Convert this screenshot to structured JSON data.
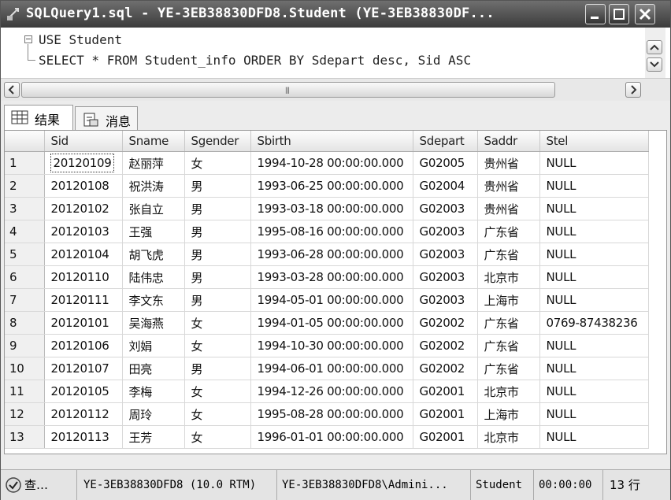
{
  "window": {
    "title": "SQLQuery1.sql - YE-3EB38830DFD8.Student (YE-3EB38830DF..."
  },
  "editor": {
    "line1": "USE Student",
    "line2": "SELECT * FROM Student_info ORDER BY Sdepart desc, Sid ASC"
  },
  "tabs": {
    "results": "结果",
    "messages": "消息"
  },
  "grid": {
    "columns": [
      "Sid",
      "Sname",
      "Sgender",
      "Sbirth",
      "Sdepart",
      "Saddr",
      "Stel"
    ],
    "rows": [
      [
        "1",
        "20120109",
        "赵丽萍",
        "女",
        "1994-10-28 00:00:00.000",
        "G02005",
        "贵州省",
        "NULL"
      ],
      [
        "2",
        "20120108",
        "祝洪涛",
        "男",
        "1993-06-25 00:00:00.000",
        "G02004",
        "贵州省",
        "NULL"
      ],
      [
        "3",
        "20120102",
        "张自立",
        "男",
        "1993-03-18 00:00:00.000",
        "G02003",
        "贵州省",
        "NULL"
      ],
      [
        "4",
        "20120103",
        "王强",
        "男",
        "1995-08-16 00:00:00.000",
        "G02003",
        "广东省",
        "NULL"
      ],
      [
        "5",
        "20120104",
        "胡飞虎",
        "男",
        "1993-06-28 00:00:00.000",
        "G02003",
        "广东省",
        "NULL"
      ],
      [
        "6",
        "20120110",
        "陆伟忠",
        "男",
        "1993-03-28 00:00:00.000",
        "G02003",
        "北京市",
        "NULL"
      ],
      [
        "7",
        "20120111",
        "李文东",
        "男",
        "1994-05-01 00:00:00.000",
        "G02003",
        "上海市",
        "NULL"
      ],
      [
        "8",
        "20120101",
        "吴海燕",
        "女",
        "1994-01-05 00:00:00.000",
        "G02002",
        "广东省",
        "0769-87438236"
      ],
      [
        "9",
        "20120106",
        "刘娟",
        "女",
        "1994-10-30 00:00:00.000",
        "G02002",
        "广东省",
        "NULL"
      ],
      [
        "10",
        "20120107",
        "田亮",
        "男",
        "1994-06-01 00:00:00.000",
        "G02002",
        "广东省",
        "NULL"
      ],
      [
        "11",
        "20120105",
        "李梅",
        "女",
        "1994-12-26 00:00:00.000",
        "G02001",
        "北京市",
        "NULL"
      ],
      [
        "12",
        "20120112",
        "周玲",
        "女",
        "1995-08-28 00:00:00.000",
        "G02001",
        "上海市",
        "NULL"
      ],
      [
        "13",
        "20120113",
        "王芳",
        "女",
        "1996-01-01 00:00:00.000",
        "G02001",
        "北京市",
        "NULL"
      ]
    ]
  },
  "status": {
    "query_state": "查…",
    "server": "YE-3EB38830DFD8 (10.0 RTM)",
    "user": "YE-3EB38830DFD8\\Admini...",
    "database": "Student",
    "elapsed": "00:00:00",
    "rows": "13 行"
  }
}
